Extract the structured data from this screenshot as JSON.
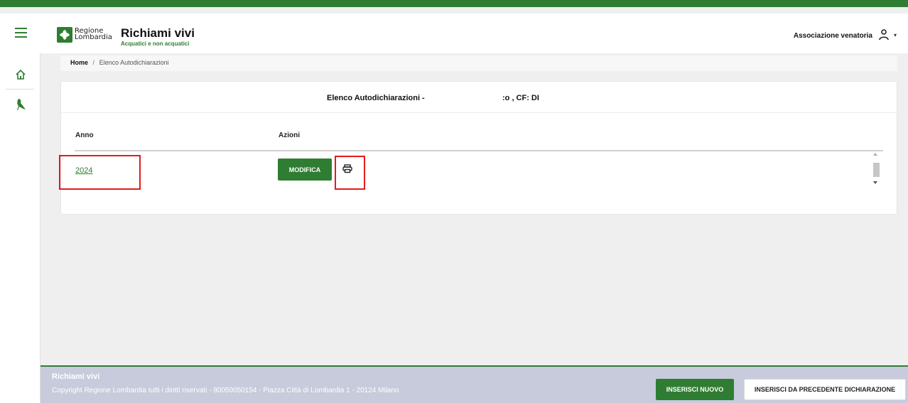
{
  "header": {
    "logo_line1": "Regione",
    "logo_line2": "Lombardia",
    "app_title": "Richiami vivi",
    "app_subtitle": "Acquatici e non acquatici",
    "user_label": "Associazione venatoria"
  },
  "sidebar": {
    "items": [
      {
        "icon": "home-icon"
      },
      {
        "icon": "bird-icon"
      }
    ]
  },
  "breadcrumb": {
    "home": "Home",
    "separator": "/",
    "current": "Elenco Autodichiarazioni"
  },
  "card": {
    "title": "Elenco Autodichiarazioni -",
    "title_suffix": ":o , CF: DI",
    "columns": [
      "Anno",
      "Azioni"
    ],
    "rows": [
      {
        "anno": "2024",
        "action_label": "MODIFICA"
      }
    ]
  },
  "footer": {
    "title": "Richiami vivi",
    "copyright": "Copyright Regione Lombardia tutti i diritti riservati - 80050050154 - Piazza Città di Lombardia 1 - 20124 Milano",
    "btn_nuovo": "INSERISCI NUOVO",
    "btn_precedente": "INSERISCI DA PRECEDENTE DICHIARAZIONE"
  },
  "colors": {
    "brand_green": "#2f7d32",
    "highlight_red": "#e31b1b",
    "footer_bg": "#c7cbdb"
  }
}
